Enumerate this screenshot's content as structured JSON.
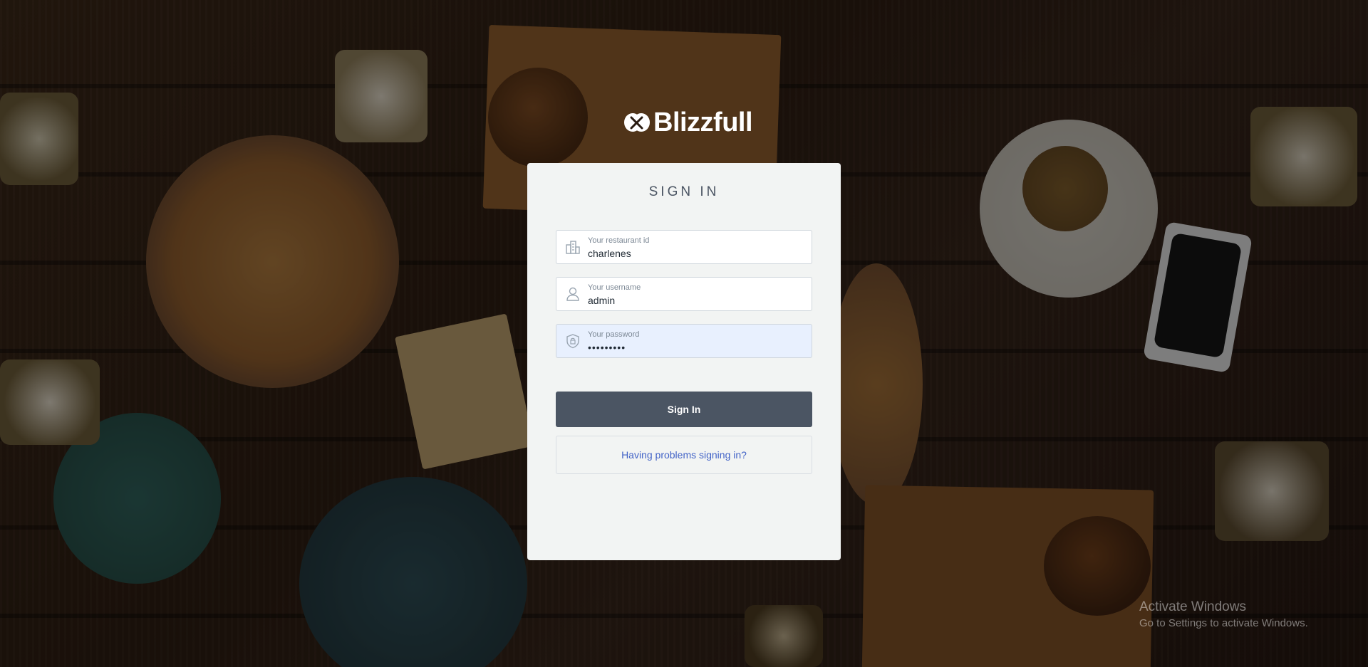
{
  "logo": {
    "text": "Blizzfull"
  },
  "signin": {
    "title": "SIGN IN",
    "restaurant": {
      "label": "Your restaurant id",
      "value": "charlenes",
      "icon": "building-icon"
    },
    "username": {
      "label": "Your username",
      "value": "admin",
      "icon": "user-icon"
    },
    "password": {
      "label": "Your password",
      "value": "•••••••••",
      "icon": "shield-lock-icon"
    },
    "submit_label": "Sign In",
    "help_link": "Having problems signing in?"
  },
  "watermark": {
    "line1": "Activate Windows",
    "line2": "Go to Settings to activate Windows."
  },
  "colors": {
    "card_bg": "#f2f4f3",
    "primary_button": "#4b5563",
    "link": "#4263c7",
    "autofill": "#e8f0fe"
  }
}
